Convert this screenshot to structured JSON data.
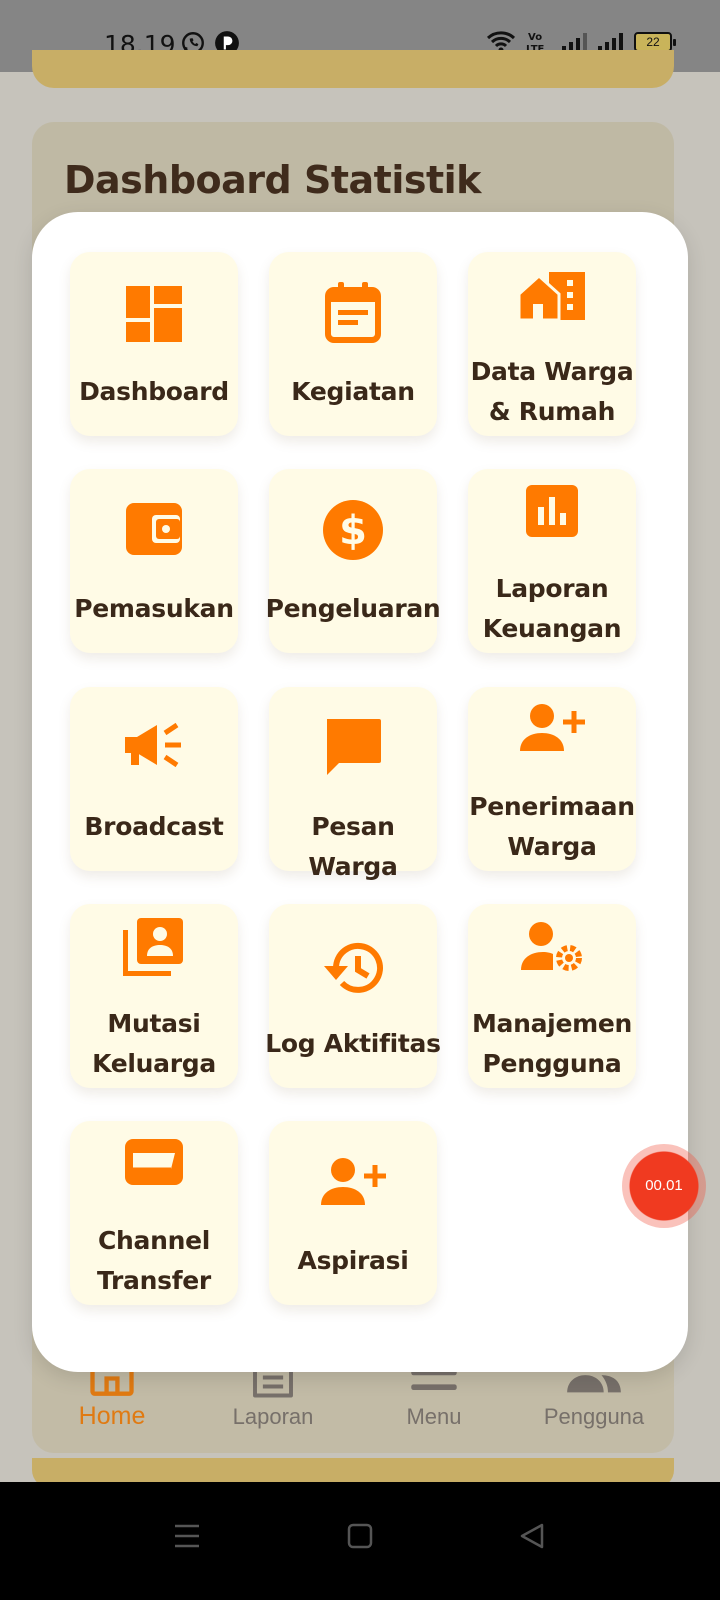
{
  "status_bar": {
    "time": "18.19",
    "battery": "22",
    "icons": [
      "whatsapp-icon",
      "app-icon",
      "wifi-icon",
      "volte-icon",
      "signal-icon",
      "signal-icon",
      "battery-icon"
    ]
  },
  "background": {
    "dashboard_title": "Dashboard Statistik"
  },
  "menu": {
    "accent_color": "#ff7a00",
    "tile_color": "#fffbe6",
    "items": [
      {
        "label_lines": [
          "Dashboard"
        ],
        "icon": "dashboard-icon"
      },
      {
        "label_lines": [
          "Kegiatan"
        ],
        "icon": "calendar-icon"
      },
      {
        "label_lines": [
          "Data Warga",
          "& Rumah"
        ],
        "icon": "houses-icon"
      },
      {
        "label_lines": [
          "Pemasukan"
        ],
        "icon": "wallet-icon"
      },
      {
        "label_lines": [
          "Pengeluaran"
        ],
        "icon": "dollar-icon"
      },
      {
        "label_lines": [
          "Laporan",
          "Keuangan"
        ],
        "icon": "bar-chart-icon"
      },
      {
        "label_lines": [
          "Broadcast"
        ],
        "icon": "megaphone-icon"
      },
      {
        "label_lines": [
          "Pesan Warga"
        ],
        "icon": "message-icon"
      },
      {
        "label_lines": [
          "Penerimaan",
          "Warga"
        ],
        "icon": "person-add-icon"
      },
      {
        "label_lines": [
          "Mutasi",
          "Keluarga"
        ],
        "icon": "contacts-icon"
      },
      {
        "label_lines": [
          "Log Aktifitas"
        ],
        "icon": "history-icon"
      },
      {
        "label_lines": [
          "Manajemen",
          "Pengguna"
        ],
        "icon": "manage-accounts-icon"
      },
      {
        "label_lines": [
          "Channel",
          "Transfer"
        ],
        "icon": "card-icon"
      },
      {
        "label_lines": [
          "Aspirasi"
        ],
        "icon": "person-add-icon"
      }
    ]
  },
  "timer_label": "00.01",
  "bottom_nav": {
    "items": [
      {
        "label": "Home",
        "icon": "home-icon",
        "active": true
      },
      {
        "label": "Laporan",
        "icon": "document-icon",
        "active": false
      },
      {
        "label": "Menu",
        "icon": "menu-icon",
        "active": false
      },
      {
        "label": "Pengguna",
        "icon": "users-icon",
        "active": false
      }
    ]
  }
}
